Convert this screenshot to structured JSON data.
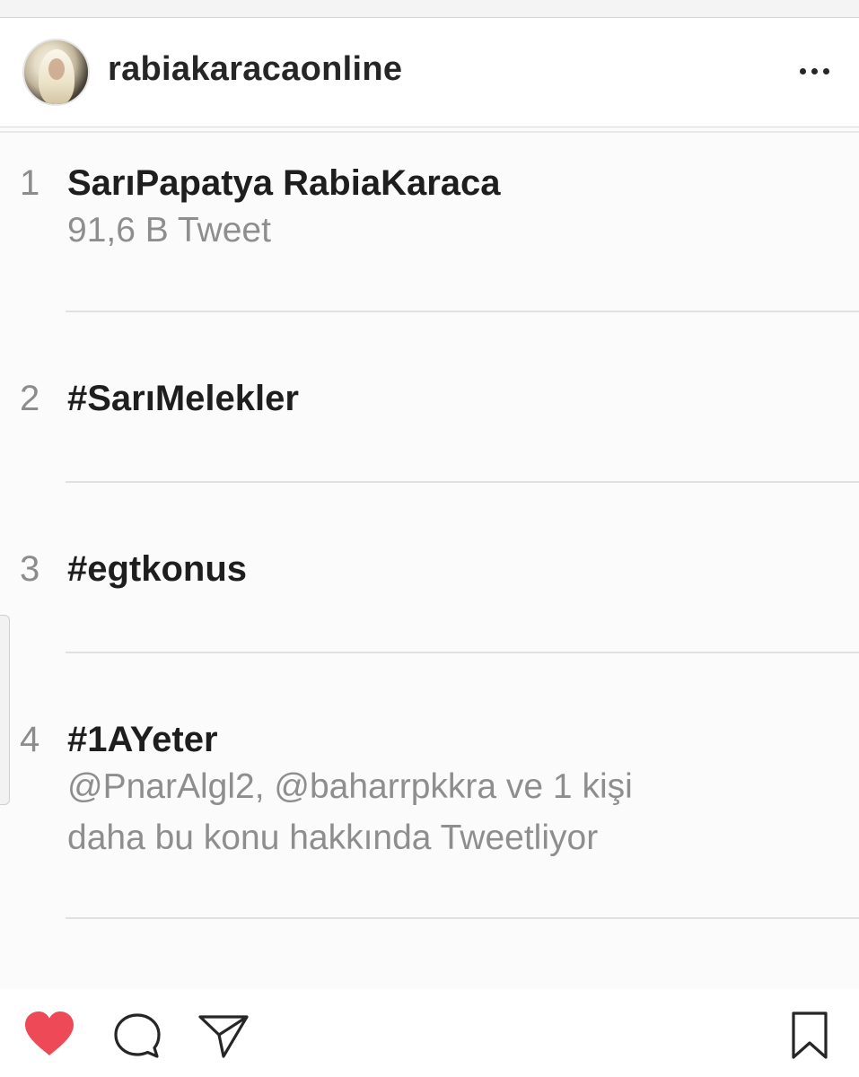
{
  "post": {
    "username": "rabiakaracaonline"
  },
  "trends": [
    {
      "rank": "1",
      "name": "SarıPapatya RabiaKaraca",
      "meta": [
        "91,6 B Tweet"
      ]
    },
    {
      "rank": "2",
      "name": "#SarıMelekler",
      "meta": []
    },
    {
      "rank": "3",
      "name": "#egtkonus",
      "meta": []
    },
    {
      "rank": "4",
      "name": "#1AYeter",
      "meta": [
        "@PnarAlgl2, @baharrpkkra ve 1 kişi",
        "daha bu konu hakkında Tweetliyor"
      ]
    }
  ],
  "icons": {
    "more": "more-options-icon",
    "like": "heart-icon",
    "comment": "comment-bubble-icon",
    "share": "paper-plane-icon",
    "save": "bookmark-icon"
  },
  "colors": {
    "like_active": "#ed4956",
    "text_primary": "#262626",
    "text_secondary": "#8e8e8e"
  }
}
